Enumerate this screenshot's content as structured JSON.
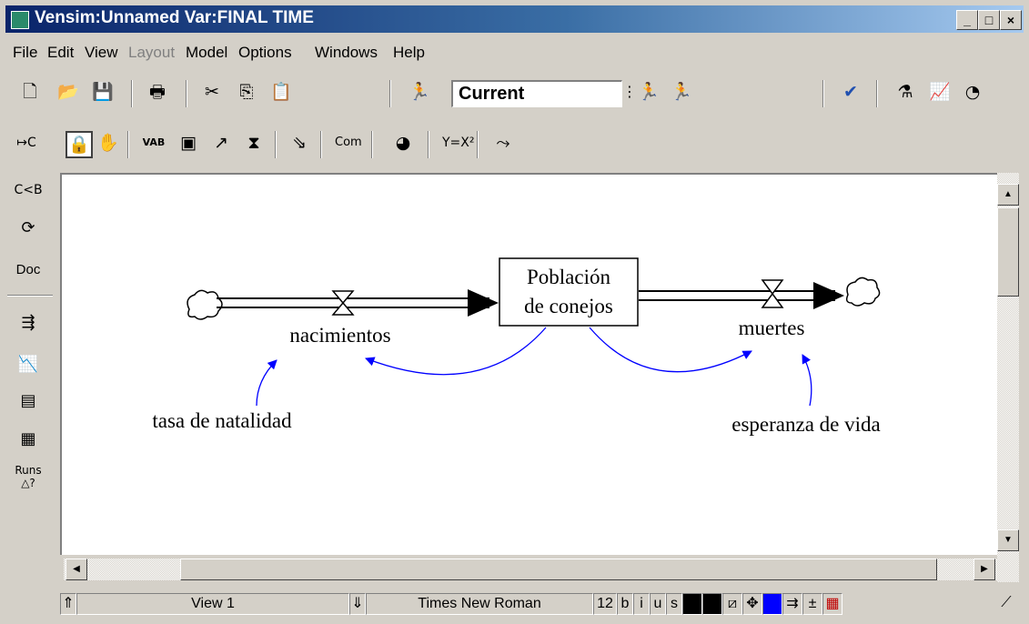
{
  "window": {
    "title": "Vensim:Unnamed Var:FINAL TIME"
  },
  "caption_buttons": {
    "minimize": "_",
    "maximize": "□",
    "close": "×"
  },
  "menu": [
    {
      "label": "File",
      "enabled": true
    },
    {
      "label": "Edit",
      "enabled": true
    },
    {
      "label": "View",
      "enabled": true
    },
    {
      "label": "Layout",
      "enabled": false
    },
    {
      "label": "Model",
      "enabled": true
    },
    {
      "label": "Options",
      "enabled": true
    },
    {
      "label": "Windows",
      "enabled": true
    },
    {
      "label": "Help",
      "enabled": true
    }
  ],
  "toolbar": {
    "run_name": "Current",
    "icons": [
      "new-icon",
      "open-icon",
      "save-icon",
      "print-icon",
      "cut-icon",
      "copy-icon",
      "paste-icon",
      "set-simulation-icon",
      "simulate-icon",
      "synthesim-icon",
      "check-model-icon",
      "reality-check-icon",
      "graph-icon",
      "gauge-icon"
    ]
  },
  "sketch_tools": {
    "com_label": "Com",
    "vab_label": "VAB"
  },
  "left_tools": {
    "doc_label": "Doc",
    "runs_label": "Runs"
  },
  "diagram": {
    "stock": {
      "line1": "Población",
      "line2": "de conejos"
    },
    "inflow": "nacimientos",
    "outflow": "muertes",
    "aux1": "tasa de natalidad",
    "aux2": "esperanza de vida",
    "arrow_color": "#0000ff"
  },
  "status": {
    "view": "View 1",
    "font": "Times New Roman",
    "size": "12",
    "bold": "b",
    "italic": "i",
    "underline": "u",
    "strike": "s"
  }
}
